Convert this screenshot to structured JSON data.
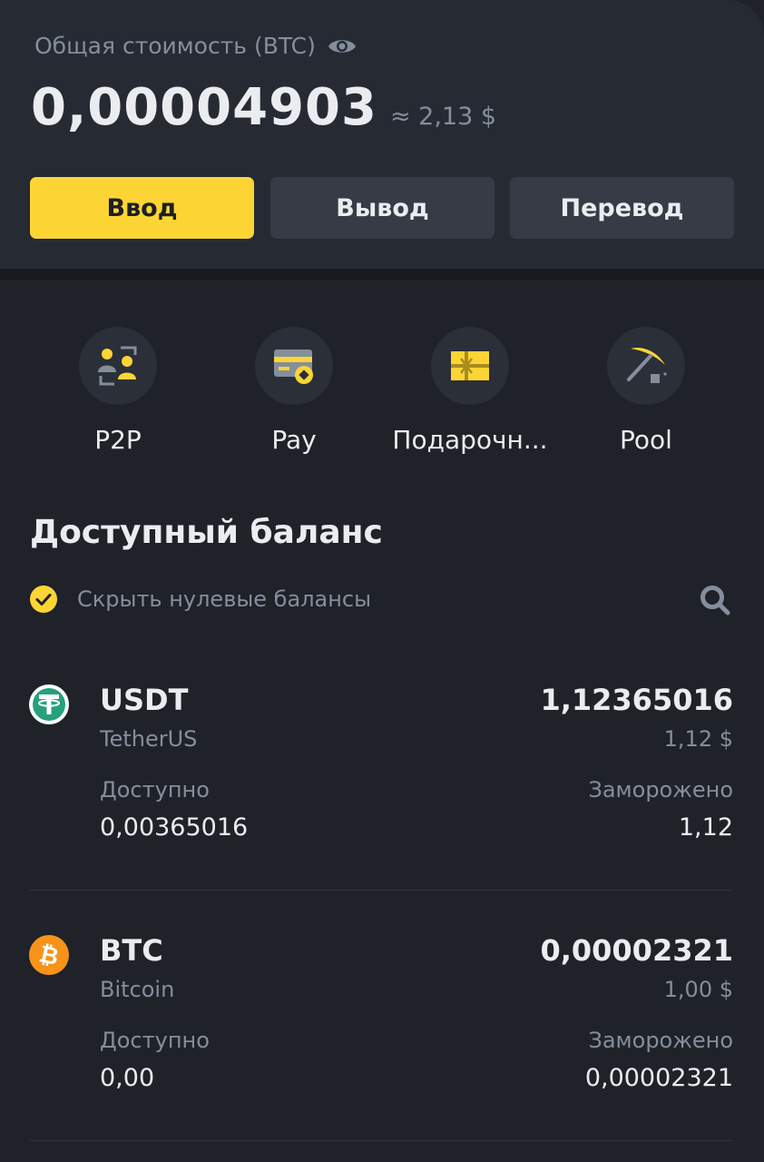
{
  "header": {
    "total_label": "Общая стоимость (BTC)",
    "total_value": "0,00004903",
    "total_fiat": "≈ 2,13 $"
  },
  "actions": {
    "deposit": "Ввод",
    "withdraw": "Вывод",
    "transfer": "Перевод"
  },
  "quick_links": [
    {
      "label": "P2P",
      "icon": "p2p-icon"
    },
    {
      "label": "Pay",
      "icon": "pay-card-icon"
    },
    {
      "label": "Подарочн...",
      "icon": "gift-card-icon"
    },
    {
      "label": "Pool",
      "icon": "pickaxe-icon"
    }
  ],
  "balance": {
    "title": "Доступный баланс",
    "hide_zero_label": "Скрыть нулевые балансы",
    "hide_zero_checked": true
  },
  "assets": [
    {
      "symbol": "USDT",
      "name": "TetherUS",
      "total": "1,12365016",
      "fiat": "1,12 $",
      "available_label": "Доступно",
      "available": "0,00365016",
      "frozen_label": "Заморожено",
      "frozen": "1,12",
      "icon": "tether-icon",
      "color": "#26a17b"
    },
    {
      "symbol": "BTC",
      "name": "Bitcoin",
      "total": "0,00002321",
      "fiat": "1,00 $",
      "available_label": "Доступно",
      "available": "0,00",
      "frozen_label": "Заморожено",
      "frozen": "0,00002321",
      "icon": "bitcoin-icon",
      "color": "#f7931a"
    }
  ],
  "colors": {
    "accent": "#fcd535",
    "background": "#1f2229",
    "card": "#262a33",
    "muted_text": "#848e9c"
  }
}
